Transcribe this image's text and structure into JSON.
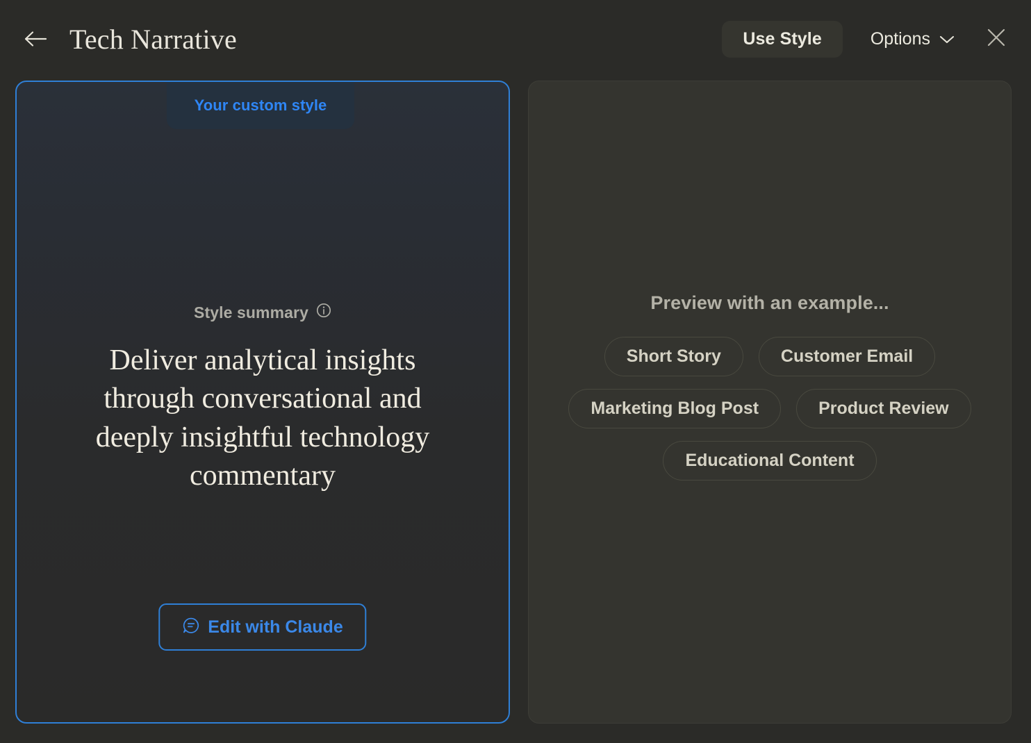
{
  "header": {
    "back_icon": "arrow-left-icon",
    "title": "Tech Narrative",
    "use_style_label": "Use Style",
    "options_label": "Options",
    "options_chevron_icon": "chevron-down-icon",
    "close_icon": "close-icon"
  },
  "style_card": {
    "badge_label": "Your custom style",
    "summary_label": "Style summary",
    "summary_info_icon": "info-icon",
    "summary_text": "Deliver analytical insights through conversational and deeply insightful technology commentary",
    "edit_button_label": "Edit with Claude",
    "edit_button_icon": "chat-bubble-icon"
  },
  "preview_panel": {
    "title": "Preview with an example...",
    "examples": [
      {
        "label": "Short Story"
      },
      {
        "label": "Customer Email"
      },
      {
        "label": "Marketing Blog Post"
      },
      {
        "label": "Product Review"
      },
      {
        "label": "Educational Content"
      }
    ]
  },
  "colors": {
    "page_background": "#2b2b28",
    "accent_blue": "#2f7fd6",
    "badge_blue_text": "#2f86f5",
    "panel_background": "#34342f",
    "text_cream": "#f0ece0",
    "text_muted": "#b4b2a7"
  }
}
